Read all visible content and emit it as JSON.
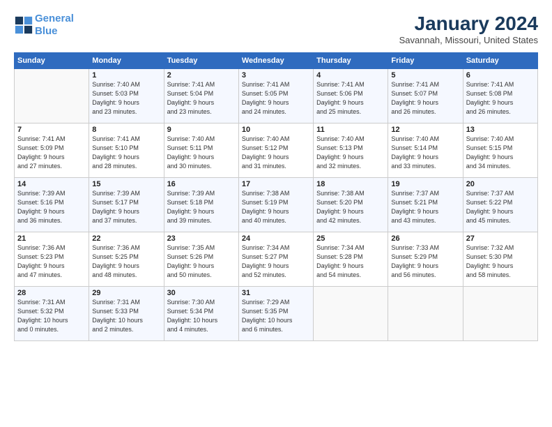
{
  "logo": {
    "line1": "General",
    "line2": "Blue"
  },
  "header": {
    "month_year": "January 2024",
    "location": "Savannah, Missouri, United States"
  },
  "weekdays": [
    "Sunday",
    "Monday",
    "Tuesday",
    "Wednesday",
    "Thursday",
    "Friday",
    "Saturday"
  ],
  "weeks": [
    [
      {
        "day": "",
        "info": ""
      },
      {
        "day": "1",
        "info": "Sunrise: 7:40 AM\nSunset: 5:03 PM\nDaylight: 9 hours\nand 23 minutes."
      },
      {
        "day": "2",
        "info": "Sunrise: 7:41 AM\nSunset: 5:04 PM\nDaylight: 9 hours\nand 23 minutes."
      },
      {
        "day": "3",
        "info": "Sunrise: 7:41 AM\nSunset: 5:05 PM\nDaylight: 9 hours\nand 24 minutes."
      },
      {
        "day": "4",
        "info": "Sunrise: 7:41 AM\nSunset: 5:06 PM\nDaylight: 9 hours\nand 25 minutes."
      },
      {
        "day": "5",
        "info": "Sunrise: 7:41 AM\nSunset: 5:07 PM\nDaylight: 9 hours\nand 26 minutes."
      },
      {
        "day": "6",
        "info": "Sunrise: 7:41 AM\nSunset: 5:08 PM\nDaylight: 9 hours\nand 26 minutes."
      }
    ],
    [
      {
        "day": "7",
        "info": "Sunrise: 7:41 AM\nSunset: 5:09 PM\nDaylight: 9 hours\nand 27 minutes."
      },
      {
        "day": "8",
        "info": "Sunrise: 7:41 AM\nSunset: 5:10 PM\nDaylight: 9 hours\nand 28 minutes."
      },
      {
        "day": "9",
        "info": "Sunrise: 7:40 AM\nSunset: 5:11 PM\nDaylight: 9 hours\nand 30 minutes."
      },
      {
        "day": "10",
        "info": "Sunrise: 7:40 AM\nSunset: 5:12 PM\nDaylight: 9 hours\nand 31 minutes."
      },
      {
        "day": "11",
        "info": "Sunrise: 7:40 AM\nSunset: 5:13 PM\nDaylight: 9 hours\nand 32 minutes."
      },
      {
        "day": "12",
        "info": "Sunrise: 7:40 AM\nSunset: 5:14 PM\nDaylight: 9 hours\nand 33 minutes."
      },
      {
        "day": "13",
        "info": "Sunrise: 7:40 AM\nSunset: 5:15 PM\nDaylight: 9 hours\nand 34 minutes."
      }
    ],
    [
      {
        "day": "14",
        "info": "Sunrise: 7:39 AM\nSunset: 5:16 PM\nDaylight: 9 hours\nand 36 minutes."
      },
      {
        "day": "15",
        "info": "Sunrise: 7:39 AM\nSunset: 5:17 PM\nDaylight: 9 hours\nand 37 minutes."
      },
      {
        "day": "16",
        "info": "Sunrise: 7:39 AM\nSunset: 5:18 PM\nDaylight: 9 hours\nand 39 minutes."
      },
      {
        "day": "17",
        "info": "Sunrise: 7:38 AM\nSunset: 5:19 PM\nDaylight: 9 hours\nand 40 minutes."
      },
      {
        "day": "18",
        "info": "Sunrise: 7:38 AM\nSunset: 5:20 PM\nDaylight: 9 hours\nand 42 minutes."
      },
      {
        "day": "19",
        "info": "Sunrise: 7:37 AM\nSunset: 5:21 PM\nDaylight: 9 hours\nand 43 minutes."
      },
      {
        "day": "20",
        "info": "Sunrise: 7:37 AM\nSunset: 5:22 PM\nDaylight: 9 hours\nand 45 minutes."
      }
    ],
    [
      {
        "day": "21",
        "info": "Sunrise: 7:36 AM\nSunset: 5:23 PM\nDaylight: 9 hours\nand 47 minutes."
      },
      {
        "day": "22",
        "info": "Sunrise: 7:36 AM\nSunset: 5:25 PM\nDaylight: 9 hours\nand 48 minutes."
      },
      {
        "day": "23",
        "info": "Sunrise: 7:35 AM\nSunset: 5:26 PM\nDaylight: 9 hours\nand 50 minutes."
      },
      {
        "day": "24",
        "info": "Sunrise: 7:34 AM\nSunset: 5:27 PM\nDaylight: 9 hours\nand 52 minutes."
      },
      {
        "day": "25",
        "info": "Sunrise: 7:34 AM\nSunset: 5:28 PM\nDaylight: 9 hours\nand 54 minutes."
      },
      {
        "day": "26",
        "info": "Sunrise: 7:33 AM\nSunset: 5:29 PM\nDaylight: 9 hours\nand 56 minutes."
      },
      {
        "day": "27",
        "info": "Sunrise: 7:32 AM\nSunset: 5:30 PM\nDaylight: 9 hours\nand 58 minutes."
      }
    ],
    [
      {
        "day": "28",
        "info": "Sunrise: 7:31 AM\nSunset: 5:32 PM\nDaylight: 10 hours\nand 0 minutes."
      },
      {
        "day": "29",
        "info": "Sunrise: 7:31 AM\nSunset: 5:33 PM\nDaylight: 10 hours\nand 2 minutes."
      },
      {
        "day": "30",
        "info": "Sunrise: 7:30 AM\nSunset: 5:34 PM\nDaylight: 10 hours\nand 4 minutes."
      },
      {
        "day": "31",
        "info": "Sunrise: 7:29 AM\nSunset: 5:35 PM\nDaylight: 10 hours\nand 6 minutes."
      },
      {
        "day": "",
        "info": ""
      },
      {
        "day": "",
        "info": ""
      },
      {
        "day": "",
        "info": ""
      }
    ]
  ]
}
